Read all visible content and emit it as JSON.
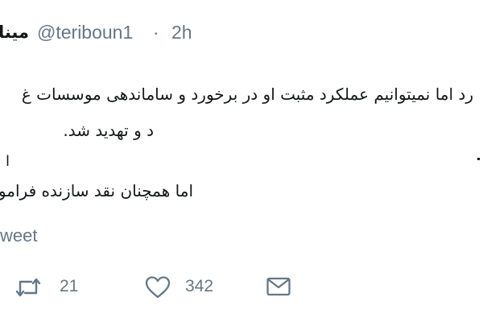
{
  "tweet": {
    "author": {
      "name": "مینا",
      "handle": "@teriboun1",
      "separator": "·",
      "time": "2h"
    },
    "body_lines": [
      "رد اما نمیتوانیم عملکرد مثبت او در برخورد و ساماندهی موسسات غ",
      "د و تهدید شد.",
      "ا",
      "اما همچنان نقد سازنده فراموش نمیشود."
    ],
    "retweet_label": "weet",
    "actions": {
      "retweet": {
        "icon": "retweet-icon",
        "count": "21"
      },
      "like": {
        "icon": "heart-icon",
        "count": "342"
      },
      "message": {
        "icon": "envelope-icon"
      }
    },
    "colors": {
      "text": "#14171a",
      "muted": "#657786",
      "background": "#ffffff"
    }
  }
}
